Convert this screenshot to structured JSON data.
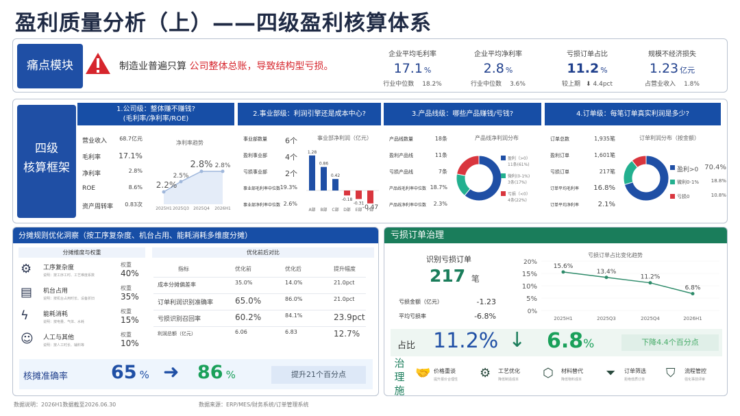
{
  "title": "盈利质量分析（上）——四级盈利核算体系",
  "pain": {
    "label": "痛点模块",
    "statement_plain": "制造业普遍只算",
    "statement_red": "公司整体总账，导致结构型亏损。",
    "metrics": [
      {
        "label": "企业平均毛利率",
        "value": "17.1",
        "unit": "%",
        "sub_label": "行业中位数",
        "sub_value": "18.2%"
      },
      {
        "label": "企业平均净利率",
        "value": "2.8",
        "unit": "%",
        "sub_label": "行业中位数",
        "sub_value": "3.6%"
      },
      {
        "label": "亏损订单占比",
        "value": "11.2",
        "unit": "%",
        "sub_label": "较上期",
        "sub_value": "4.4pct"
      },
      {
        "label": "规模不经济损失",
        "value": "1.23",
        "unit": "亿元",
        "sub_label": "占营业收入",
        "sub_value": "1.8%"
      }
    ]
  },
  "framework": {
    "label_line1": "四级",
    "label_line2": "核算框架",
    "panels": {
      "company": {
        "title": "1.公司级：整体赚不赚钱?",
        "subtitle": "(毛利率/净利率/ROE)",
        "rows": [
          {
            "label": "营业收入",
            "value": "68.7亿元"
          },
          {
            "label": "毛利率",
            "value": "17.1%"
          },
          {
            "label": "净利率",
            "value": "2.8%"
          },
          {
            "label": "ROE",
            "value": "8.6%"
          },
          {
            "label": "资产周转率",
            "value": "0.83次"
          }
        ],
        "trend_title": "净利率趋势"
      },
      "dept": {
        "title": "2.事业部级：利润引擎还是成本中心?",
        "rows": [
          {
            "label": "事业部数量",
            "value": "6个"
          },
          {
            "label": "盈利事业部",
            "value": "4个"
          },
          {
            "label": "亏损事业部",
            "value": "2个"
          },
          {
            "label": "事业部毛利率中位数",
            "value": "19.3%"
          },
          {
            "label": "事业部净利率中位数",
            "value": "2.6%"
          }
        ],
        "chart_title": "事业部净利润（亿元）"
      },
      "product": {
        "title": "3.产品线级：哪些产品赚钱/亏钱?",
        "rows": [
          {
            "label": "产品线数量",
            "value": "18条"
          },
          {
            "label": "盈利产品线",
            "value": "11条"
          },
          {
            "label": "亏损产品线",
            "value": "7条"
          },
          {
            "label": "产品线毛利率中位数",
            "value": "18.7%"
          },
          {
            "label": "产品线净利率中位数",
            "value": "2.3%"
          }
        ],
        "chart_title": "产品线净利润分布",
        "legend": [
          {
            "label": "盈利（>0）",
            "sub": "11条(61%)",
            "color": "#1f4fa5"
          },
          {
            "label": "微利(0-1%)",
            "sub": "3条(17%)",
            "color": "#23b08f"
          },
          {
            "label": "亏损（<0）",
            "sub": "4条(22%)",
            "color": "#d9363e"
          }
        ]
      },
      "order": {
        "title": "4.订单级：每笔订单真实利润是多少?",
        "rows": [
          {
            "label": "订单总数",
            "value": "1,935笔"
          },
          {
            "label": "盈利订单",
            "value": "1,601笔"
          },
          {
            "label": "亏损订单",
            "value": "217笔"
          },
          {
            "label": "订单平均毛利率",
            "value": "16.8%"
          },
          {
            "label": "订单平均净利率",
            "value": "2.1%"
          }
        ],
        "chart_title": "订单利润分布（按金额）",
        "legend": [
          {
            "label": "盈利>0",
            "value": "70.4%",
            "color": "#1f4fa5"
          },
          {
            "label": "微利0-1%",
            "value": "18.8%",
            "color": "#23b08f"
          },
          {
            "label": "亏损0",
            "value": "10.8%",
            "color": "#d9363e"
          }
        ]
      }
    }
  },
  "allocation": {
    "title": "分摊规则优化洞察（按工序复杂度、机台占用、能耗消耗多维度分摊）",
    "dim_header": "分摊维度与权重",
    "dims": [
      {
        "name": "工序复杂度",
        "desc": "说明：按工序工时、工艺难度系数",
        "weight_label": "权重",
        "weight": "40%",
        "icon": "gear-icon"
      },
      {
        "name": "机台占用",
        "desc": "说明：按机台占用时长、设备折旧",
        "weight_label": "权重",
        "weight": "35%",
        "icon": "machine-icon"
      },
      {
        "name": "能耗消耗",
        "desc": "说明：按电量、气体、水耗",
        "weight_label": "权重",
        "weight": "15%",
        "icon": "lightning-icon"
      },
      {
        "name": "人工与其他",
        "desc": "说明：按人工时长、辅料等",
        "weight_label": "权重",
        "weight": "10%",
        "icon": "person-icon"
      }
    ],
    "compare_header": "优化前后对比",
    "columns": [
      "指标",
      "优化前",
      "优化后",
      "提升幅度"
    ],
    "rows": [
      [
        "成本分摊偏差率",
        "35.0%",
        "14.0%",
        "21.0pct"
      ],
      [
        "订单利润识别准确率",
        "65.0%",
        "86.0%",
        "21.0pct"
      ],
      [
        "亏损识别召回率",
        "60.2%",
        "84.1%",
        "23.9pct"
      ],
      [
        "利润总额（亿元）",
        "6.06",
        "6.83",
        "12.7%"
      ]
    ],
    "accuracy_label": "核摊准确率",
    "acc_before": "65",
    "acc_after": "86",
    "acc_unit": "%",
    "acc_chip": "提升21个百分点"
  },
  "loss": {
    "title": "亏损订单治理",
    "identify_label": "识别亏损订单",
    "identify_value": "217",
    "identify_unit": "笔",
    "rows": [
      {
        "label": "亏损金额（亿元）",
        "value": "-1.23"
      },
      {
        "label": "平均亏损率",
        "value": "-6.8%"
      }
    ],
    "trend_title": "亏损订单占比变化趋势",
    "share_label": "占比",
    "share_before": "11.2%",
    "share_after": "6.8",
    "share_unit": "%",
    "share_chip": "下降4.4个百分点",
    "gov_label": "治理施",
    "measures": [
      {
        "name": "价格重谈",
        "desc": "提升报价合理性",
        "icon": "handshake-icon"
      },
      {
        "name": "工艺优化",
        "desc": "降低制造成本",
        "icon": "gear-icon"
      },
      {
        "name": "材料替代",
        "desc": "降低物料成本",
        "icon": "box-icon"
      },
      {
        "name": "订单筛选",
        "desc": "拒绝低质订单",
        "icon": "filter-icon"
      },
      {
        "name": "流程管控",
        "desc": "强化事前评审",
        "icon": "shield-icon"
      }
    ]
  },
  "footer": {
    "note": "数据说明：2026H1数据截至2026.06.30",
    "source": "数据来源：ERP/MES/财务系统/订单管理系统"
  },
  "chart_data": [
    {
      "type": "line",
      "title": "净利率趋势",
      "x": [
        "2025H1",
        "2025Q3",
        "2025Q4",
        "2026H1"
      ],
      "series": [
        {
          "values": [
            2.2,
            2.5,
            2.8,
            2.8
          ]
        }
      ],
      "labels": [
        "2.2%",
        "2.5%",
        "2.8%",
        "2.8%"
      ]
    },
    {
      "type": "bar",
      "title": "事业部净利润（亿元）",
      "categories": [
        "A部",
        "B部",
        "C部",
        "D部",
        "E部",
        "F部"
      ],
      "values": [
        1.28,
        0.86,
        0.42,
        -0.18,
        -0.31,
        -0.47
      ]
    },
    {
      "type": "pie",
      "title": "产品线净利润分布",
      "slices": [
        {
          "label": "盈利（>0）",
          "value": 61
        },
        {
          "label": "微利(0-1%)",
          "value": 17
        },
        {
          "label": "亏损（<0）",
          "value": 22
        }
      ]
    },
    {
      "type": "pie",
      "title": "订单利润分布（按金额）",
      "slices": [
        {
          "label": "盈利>0",
          "value": 70.4
        },
        {
          "label": "微利0-1%",
          "value": 18.8
        },
        {
          "label": "亏损0",
          "value": 10.8
        }
      ]
    },
    {
      "type": "line",
      "title": "亏损订单占比变化趋势",
      "x": [
        "2025H1",
        "2025Q3",
        "2025Q4",
        "2026H1"
      ],
      "series": [
        {
          "values": [
            15.6,
            13.4,
            11.2,
            6.8
          ]
        }
      ],
      "yticks": [
        "0%",
        "5%",
        "10%",
        "15%",
        "20%"
      ],
      "ylim": [
        0,
        20
      ]
    }
  ]
}
